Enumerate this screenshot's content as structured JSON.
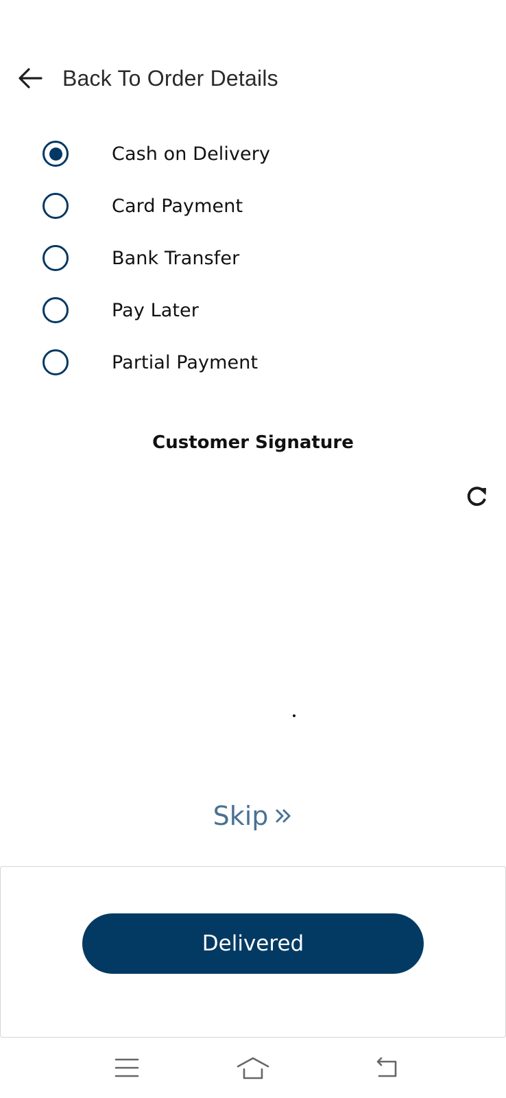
{
  "header": {
    "back_icon": "arrow-left-icon",
    "title": "Back To Order Details"
  },
  "payment": {
    "selected": "Cash on Delivery",
    "accent_color": "#023863",
    "options": [
      {
        "label": "Cash on Delivery",
        "checked": true
      },
      {
        "label": "Card Payment",
        "checked": false
      },
      {
        "label": "Bank Transfer",
        "checked": false
      },
      {
        "label": "Pay Later",
        "checked": false
      },
      {
        "label": "Partial Payment",
        "checked": false
      }
    ]
  },
  "signature": {
    "title": "Customer Signature",
    "refresh_icon": "refresh-icon"
  },
  "skip": {
    "label": "Skip",
    "icon": "double-chevron-right-icon",
    "color": "#4a7193"
  },
  "footer": {
    "delivered_label": "Delivered",
    "button_color": "#033a63"
  },
  "navbar": {
    "items": [
      "menu-icon",
      "home-icon",
      "back-icon"
    ]
  }
}
